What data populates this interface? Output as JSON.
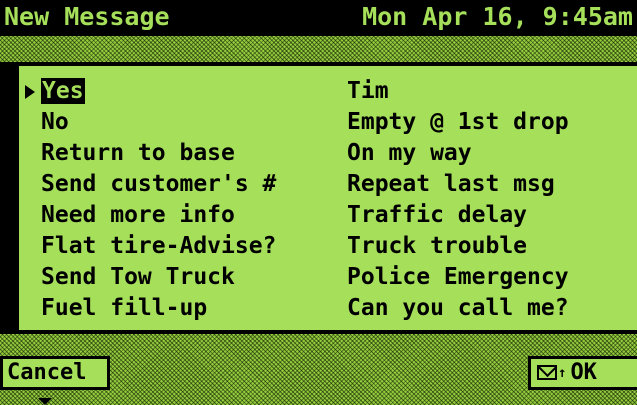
{
  "colors": {
    "lcd_green": "#a6e05a",
    "dither_green": "#93cc3c",
    "ink": "#000000"
  },
  "header": {
    "title": "New Message",
    "datetime": "Mon Apr 16, 9:45am"
  },
  "messages": {
    "left": [
      {
        "label": "Yes",
        "selected": true
      },
      {
        "label": "No"
      },
      {
        "label": "Return to base"
      },
      {
        "label": "Send customer's #"
      },
      {
        "label": "Need more info"
      },
      {
        "label": "Flat tire-Advise?"
      },
      {
        "label": "Send Tow Truck"
      },
      {
        "label": "Fuel fill-up"
      }
    ],
    "right": [
      {
        "label": "Tim"
      },
      {
        "label": "Empty @ 1st drop"
      },
      {
        "label": "On my way"
      },
      {
        "label": "Repeat last msg"
      },
      {
        "label": "Traffic delay"
      },
      {
        "label": "Truck trouble"
      },
      {
        "label": "Police Emergency"
      },
      {
        "label": "Can you call me?"
      }
    ]
  },
  "softkeys": {
    "cancel_label": "Cancel",
    "ok_label": "OK",
    "ok_icons": [
      "envelope-icon",
      "signal-icon"
    ]
  }
}
